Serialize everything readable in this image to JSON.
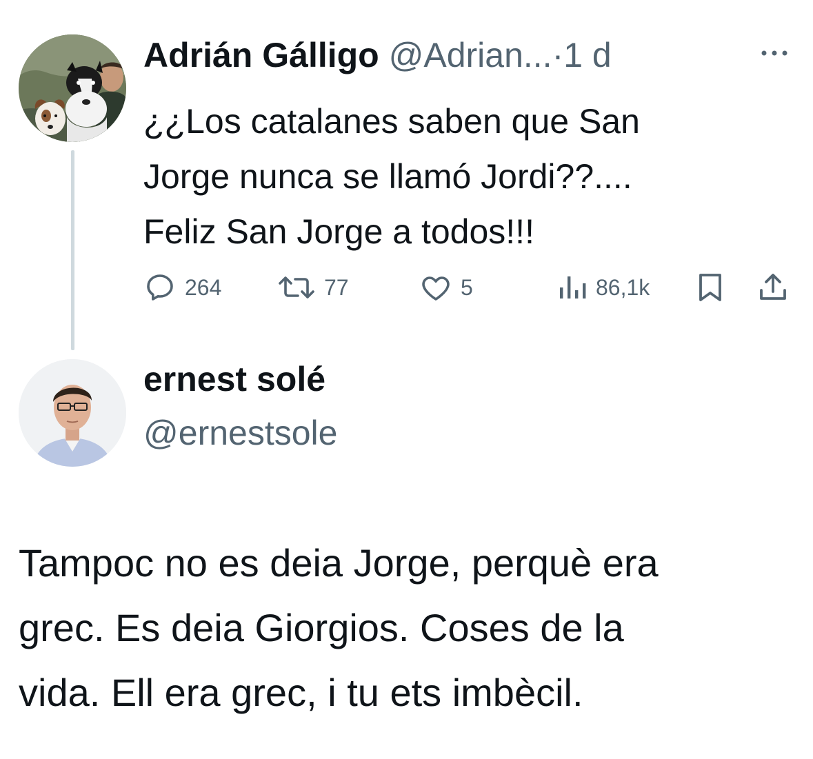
{
  "parent_tweet": {
    "display_name": "Adrián Gálligo",
    "handle": "@Adrian...",
    "separator": "·",
    "time": "1 d",
    "text_lines": [
      "¿¿Los catalanes saben que San",
      "Jorge nunca se llamó Jordi??....",
      "Feliz San Jorge a todos!!!"
    ],
    "actions": {
      "replies": "264",
      "retweets": "77",
      "likes": "5",
      "views": "86,1k"
    },
    "icons": {
      "more": "more-horizontal-icon",
      "reply": "reply-bubble-icon",
      "retweet": "retweet-icon",
      "like": "heart-icon",
      "views": "views-bar-chart-icon",
      "bookmark": "bookmark-icon",
      "share": "share-upload-icon"
    }
  },
  "reply": {
    "display_name": "ernest solé",
    "handle": "@ernestsole",
    "text_lines": [
      "Tampoc no es deia Jorge, perquè era",
      "grec. Es deia Giorgios. Coses de la",
      "vida. Ell era grec, i tu ets imbècil."
    ]
  },
  "colors": {
    "text_primary": "#0f1419",
    "text_secondary": "#536471",
    "thread_line": "#cfd9de",
    "background": "#ffffff"
  }
}
